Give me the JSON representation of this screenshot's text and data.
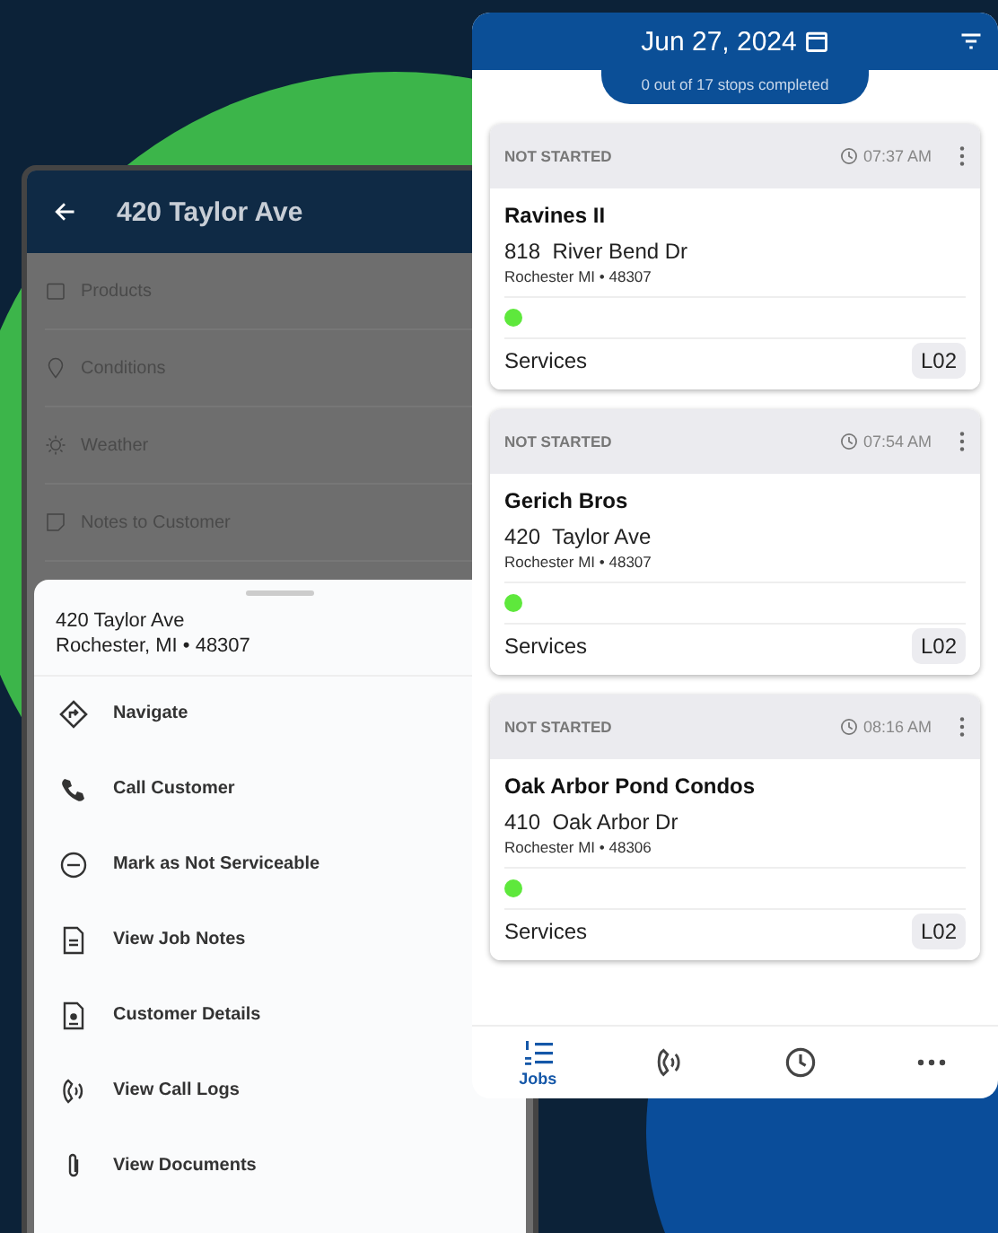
{
  "detail_screen": {
    "title": "420 Taylor Ave",
    "menu": [
      {
        "label": "Products",
        "kind": "box"
      },
      {
        "label": "Conditions",
        "kind": "pin"
      },
      {
        "label": "Weather",
        "kind": "sun"
      },
      {
        "label": "Notes to Customer",
        "kind": "note"
      }
    ],
    "sheet": {
      "address": "420 Taylor Ave",
      "city": "Rochester, MI • 48307",
      "actions": [
        {
          "label": "Navigate",
          "kind": "navigate"
        },
        {
          "label": "Call Customer",
          "kind": "phone"
        },
        {
          "label": "Mark as Not Serviceable",
          "kind": "minus"
        },
        {
          "label": "View Job Notes",
          "kind": "doc"
        },
        {
          "label": "Customer Details",
          "kind": "person"
        },
        {
          "label": "View Call Logs",
          "kind": "calllog"
        },
        {
          "label": "View Documents",
          "kind": "clip"
        }
      ]
    }
  },
  "jobs_screen": {
    "date": "Jun 27, 2024",
    "progress": "0 out of 17 stops completed",
    "jobs": [
      {
        "status": "NOT STARTED",
        "time": "07:37 AM",
        "name": "Ravines II",
        "street": "818  River Bend Dr",
        "city": "Rochester MI • 48307",
        "color": "#5ee83c",
        "services": "Services",
        "code": "L02"
      },
      {
        "status": "NOT STARTED",
        "time": "07:54 AM",
        "name": "Gerich Bros",
        "street": "420  Taylor Ave",
        "city": "Rochester MI • 48307",
        "color": "#5ee83c",
        "services": "Services",
        "code": "L02"
      },
      {
        "status": "NOT STARTED",
        "time": "08:16 AM",
        "name": "Oak Arbor Pond Condos",
        "street": "410  Oak Arbor Dr",
        "city": "Rochester MI • 48306",
        "color": "#5ee83c",
        "services": "Services",
        "code": "L02"
      }
    ],
    "nav": [
      {
        "kind": "jobs",
        "label": "Jobs",
        "selected": true
      },
      {
        "kind": "calls",
        "selected": false
      },
      {
        "kind": "clock",
        "selected": false
      },
      {
        "kind": "more",
        "selected": false
      }
    ]
  }
}
